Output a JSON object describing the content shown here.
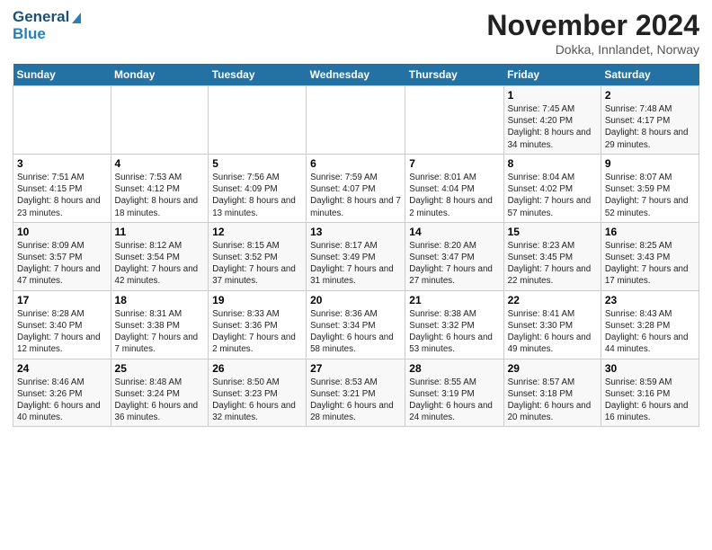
{
  "logo": {
    "line1": "General",
    "line2": "Blue"
  },
  "title": "November 2024",
  "subtitle": "Dokka, Innlandet, Norway",
  "days_header": [
    "Sunday",
    "Monday",
    "Tuesday",
    "Wednesday",
    "Thursday",
    "Friday",
    "Saturday"
  ],
  "weeks": [
    [
      {
        "num": "",
        "info": ""
      },
      {
        "num": "",
        "info": ""
      },
      {
        "num": "",
        "info": ""
      },
      {
        "num": "",
        "info": ""
      },
      {
        "num": "",
        "info": ""
      },
      {
        "num": "1",
        "info": "Sunrise: 7:45 AM\nSunset: 4:20 PM\nDaylight: 8 hours\nand 34 minutes."
      },
      {
        "num": "2",
        "info": "Sunrise: 7:48 AM\nSunset: 4:17 PM\nDaylight: 8 hours\nand 29 minutes."
      }
    ],
    [
      {
        "num": "3",
        "info": "Sunrise: 7:51 AM\nSunset: 4:15 PM\nDaylight: 8 hours\nand 23 minutes."
      },
      {
        "num": "4",
        "info": "Sunrise: 7:53 AM\nSunset: 4:12 PM\nDaylight: 8 hours\nand 18 minutes."
      },
      {
        "num": "5",
        "info": "Sunrise: 7:56 AM\nSunset: 4:09 PM\nDaylight: 8 hours\nand 13 minutes."
      },
      {
        "num": "6",
        "info": "Sunrise: 7:59 AM\nSunset: 4:07 PM\nDaylight: 8 hours\nand 7 minutes."
      },
      {
        "num": "7",
        "info": "Sunrise: 8:01 AM\nSunset: 4:04 PM\nDaylight: 8 hours\nand 2 minutes."
      },
      {
        "num": "8",
        "info": "Sunrise: 8:04 AM\nSunset: 4:02 PM\nDaylight: 7 hours\nand 57 minutes."
      },
      {
        "num": "9",
        "info": "Sunrise: 8:07 AM\nSunset: 3:59 PM\nDaylight: 7 hours\nand 52 minutes."
      }
    ],
    [
      {
        "num": "10",
        "info": "Sunrise: 8:09 AM\nSunset: 3:57 PM\nDaylight: 7 hours\nand 47 minutes."
      },
      {
        "num": "11",
        "info": "Sunrise: 8:12 AM\nSunset: 3:54 PM\nDaylight: 7 hours\nand 42 minutes."
      },
      {
        "num": "12",
        "info": "Sunrise: 8:15 AM\nSunset: 3:52 PM\nDaylight: 7 hours\nand 37 minutes."
      },
      {
        "num": "13",
        "info": "Sunrise: 8:17 AM\nSunset: 3:49 PM\nDaylight: 7 hours\nand 31 minutes."
      },
      {
        "num": "14",
        "info": "Sunrise: 8:20 AM\nSunset: 3:47 PM\nDaylight: 7 hours\nand 27 minutes."
      },
      {
        "num": "15",
        "info": "Sunrise: 8:23 AM\nSunset: 3:45 PM\nDaylight: 7 hours\nand 22 minutes."
      },
      {
        "num": "16",
        "info": "Sunrise: 8:25 AM\nSunset: 3:43 PM\nDaylight: 7 hours\nand 17 minutes."
      }
    ],
    [
      {
        "num": "17",
        "info": "Sunrise: 8:28 AM\nSunset: 3:40 PM\nDaylight: 7 hours\nand 12 minutes."
      },
      {
        "num": "18",
        "info": "Sunrise: 8:31 AM\nSunset: 3:38 PM\nDaylight: 7 hours\nand 7 minutes."
      },
      {
        "num": "19",
        "info": "Sunrise: 8:33 AM\nSunset: 3:36 PM\nDaylight: 7 hours\nand 2 minutes."
      },
      {
        "num": "20",
        "info": "Sunrise: 8:36 AM\nSunset: 3:34 PM\nDaylight: 6 hours\nand 58 minutes."
      },
      {
        "num": "21",
        "info": "Sunrise: 8:38 AM\nSunset: 3:32 PM\nDaylight: 6 hours\nand 53 minutes."
      },
      {
        "num": "22",
        "info": "Sunrise: 8:41 AM\nSunset: 3:30 PM\nDaylight: 6 hours\nand 49 minutes."
      },
      {
        "num": "23",
        "info": "Sunrise: 8:43 AM\nSunset: 3:28 PM\nDaylight: 6 hours\nand 44 minutes."
      }
    ],
    [
      {
        "num": "24",
        "info": "Sunrise: 8:46 AM\nSunset: 3:26 PM\nDaylight: 6 hours\nand 40 minutes."
      },
      {
        "num": "25",
        "info": "Sunrise: 8:48 AM\nSunset: 3:24 PM\nDaylight: 6 hours\nand 36 minutes."
      },
      {
        "num": "26",
        "info": "Sunrise: 8:50 AM\nSunset: 3:23 PM\nDaylight: 6 hours\nand 32 minutes."
      },
      {
        "num": "27",
        "info": "Sunrise: 8:53 AM\nSunset: 3:21 PM\nDaylight: 6 hours\nand 28 minutes."
      },
      {
        "num": "28",
        "info": "Sunrise: 8:55 AM\nSunset: 3:19 PM\nDaylight: 6 hours\nand 24 minutes."
      },
      {
        "num": "29",
        "info": "Sunrise: 8:57 AM\nSunset: 3:18 PM\nDaylight: 6 hours\nand 20 minutes."
      },
      {
        "num": "30",
        "info": "Sunrise: 8:59 AM\nSunset: 3:16 PM\nDaylight: 6 hours\nand 16 minutes."
      }
    ]
  ]
}
